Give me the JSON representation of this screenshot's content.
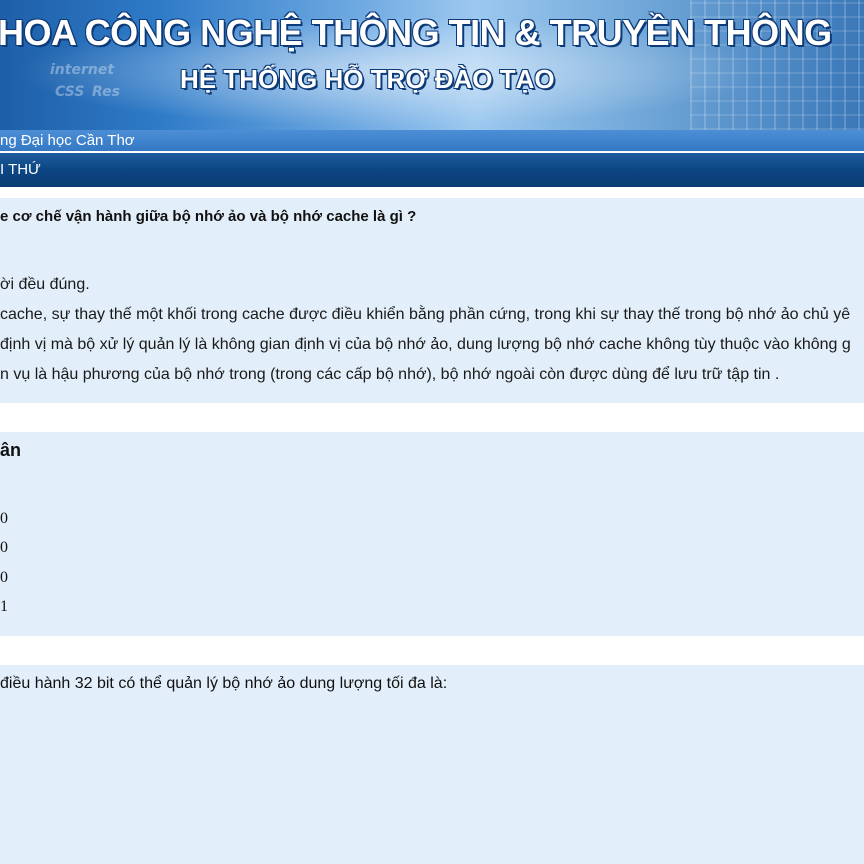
{
  "banner": {
    "title_line1": "HOA CÔNG NGHỆ THÔNG TIN & TRUYỀN THÔNG",
    "title_line2": "HỆ THỐNG HỖ TRỢ ĐÀO TẠO",
    "deco_words": [
      "internet",
      "CSS",
      "Res"
    ]
  },
  "subbar": {
    "text": "ng Đại học Cần Thơ"
  },
  "navbar": {
    "text": "I THỨ"
  },
  "question1": {
    "text": "e cơ chế vận hành giữa bộ nhớ ảo và bộ nhớ cache là gì ?",
    "options": [
      "ời đều đúng.",
      "cache, sự thay thế một khối trong cache được điều khiển bằng phần cứng, trong khi sự thay thế trong bộ nhớ ảo chủ yê",
      "định vị mà bộ xử lý quản lý là không gian định vị của bộ nhớ ảo, dung lượng bộ nhớ cache không tùy thuộc vào không g",
      "n vụ là hậu phương của bộ nhớ trong (trong các cấp bộ nhớ), bộ nhớ ngoài còn được dùng để lưu trữ tập tin ."
    ]
  },
  "question2": {
    "heading": "ân",
    "options": [
      "0",
      "0",
      "0",
      "1"
    ]
  },
  "question3": {
    "text": "điều hành 32 bit có thể quản lý bộ nhớ ảo dung lượng tối đa là:"
  }
}
